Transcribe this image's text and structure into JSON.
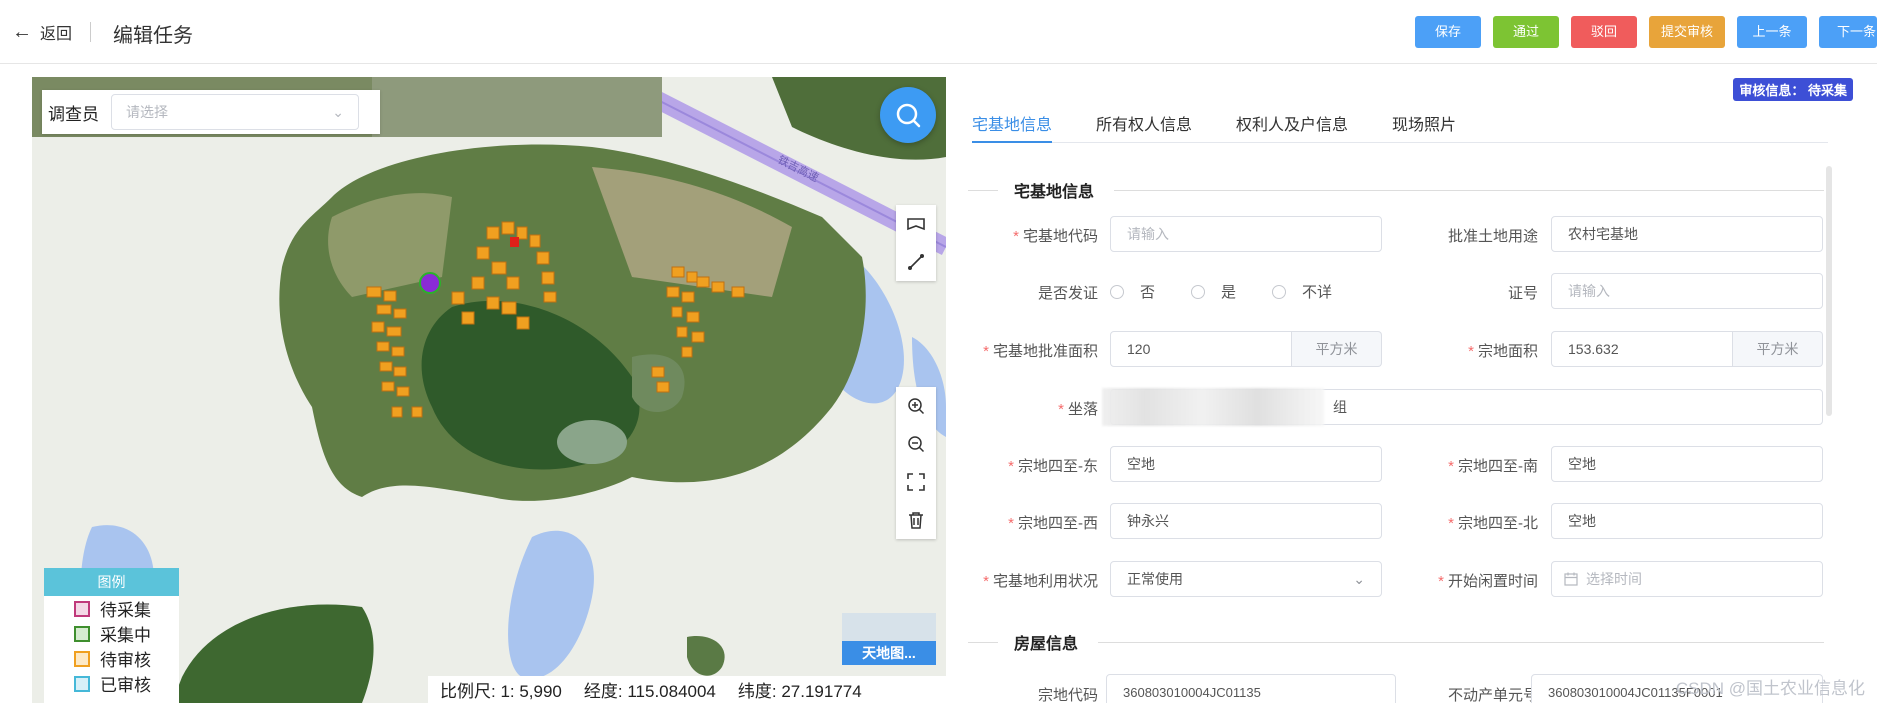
{
  "header": {
    "back_label": "返回",
    "title": "编辑任务",
    "buttons": {
      "save": "保存",
      "pass": "通过",
      "reject": "驳回",
      "submit_review": "提交审核",
      "prev": "上一条",
      "next": "下一条"
    }
  },
  "map": {
    "surveyor_label": "调查员",
    "surveyor_placeholder": "请选择",
    "road_label": "铁吉高速",
    "legend": {
      "title": "图例",
      "items": [
        {
          "label": "待采集",
          "color": "#c0397b"
        },
        {
          "label": "采集中",
          "color": "#3f8f2e"
        },
        {
          "label": "待审核",
          "color": "#f0a020"
        },
        {
          "label": "已审核",
          "color": "#45b8d8"
        }
      ]
    },
    "scale": "比例尺: 1: 5,990",
    "longitude": "经度: 115.084004",
    "latitude": "纬度: 27.191774",
    "basemap_label": "天地图..."
  },
  "panel": {
    "audit_badge": "审核信息：  待采集",
    "tabs": [
      "宅基地信息",
      "所有权人信息",
      "权利人及户信息",
      "现场照片"
    ],
    "section1_title": "宅基地信息",
    "fields": {
      "code_label": "宅基地代码",
      "code_placeholder": "请输入",
      "land_use_label": "批准土地用途",
      "land_use_value": "农村宅基地",
      "issued_label": "是否发证",
      "issued_options": [
        "否",
        "是",
        "不详"
      ],
      "cert_no_label": "证号",
      "cert_no_placeholder": "请输入",
      "approved_area_label": "宅基地批准面积",
      "approved_area_value": "120",
      "approved_area_unit": "平方米",
      "parcel_area_label": "宗地面积",
      "parcel_area_value": "153.632",
      "parcel_area_unit": "平方米",
      "location_label": "坐落",
      "location_value_tail": "组",
      "east_label": "宗地四至-东",
      "east_value": "空地",
      "south_label": "宗地四至-南",
      "south_value": "空地",
      "west_label": "宗地四至-西",
      "west_value": "钟永兴",
      "north_label": "宗地四至-北",
      "north_value": "空地",
      "usage_label": "宅基地利用状况",
      "usage_value": "正常使用",
      "idle_label": "开始闲置时间",
      "idle_placeholder": "选择时间"
    },
    "section2_title": "房屋信息",
    "house": {
      "code_label": "宗地代码",
      "code_value": "360803010004JC01135",
      "unit_label": "不动产单元号",
      "unit_value": "360803010004JC01135F0001"
    },
    "watermark": "CSDN @国土农业信息化"
  }
}
